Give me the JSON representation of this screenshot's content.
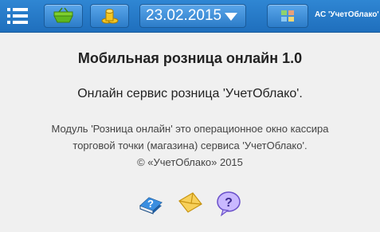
{
  "topbar": {
    "menu_icon": "hamburger-menu-icon",
    "button_1_icon": "basket-icon",
    "button_2_icon": "coins-icon",
    "date_value": "23.02.2015",
    "button_4_icon": "window-icon",
    "org_name": "АС 'УчетОблако'",
    "colors": {
      "bar": "#2f86d3",
      "button": "#4a98e0"
    }
  },
  "main": {
    "title": "Мобильная розница онлайн 1.0",
    "subtitle": "Онлайн сервис розница 'УчетОблако'.",
    "description_lines": [
      "Модуль 'Розница онлайн' это операционное окно кассира",
      "торговой точки (магазина) сервиса 'УчетОблако'.",
      "© «УчетОблако» 2015"
    ]
  },
  "footer_icons": [
    "help-book-icon",
    "envelope-icon",
    "question-bubble-icon"
  ]
}
